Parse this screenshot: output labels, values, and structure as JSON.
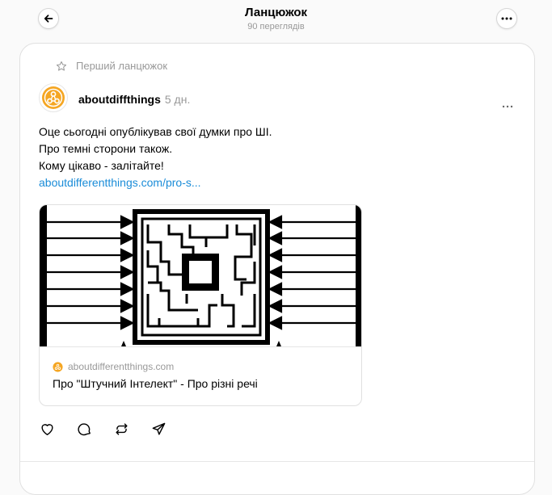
{
  "header": {
    "title": "Ланцюжок",
    "views": "90 переглядів"
  },
  "post": {
    "pinned_label": "Перший ланцюжок",
    "author": "aboutdiffthings",
    "time": "5 дн.",
    "lines": [
      "Оце сьогодні опублікував свої думки про ШІ.",
      "Про темні сторони також.",
      "Кому цікаво - залітайте!"
    ],
    "link_text": "aboutdifferentthings.com/pro-s...",
    "link_card": {
      "domain": "aboutdifferentthings.com",
      "title": "Про \"Штучний Інтелект\" - Про різні речі"
    }
  },
  "colors": {
    "accent_link": "#1a8cd8",
    "avatar_orange": "#f5a623",
    "muted": "#999999"
  },
  "icons": [
    "back-arrow-icon",
    "more-icon",
    "star-icon",
    "ellipsis-icon",
    "heart-icon",
    "comment-icon",
    "repost-icon",
    "share-icon"
  ]
}
